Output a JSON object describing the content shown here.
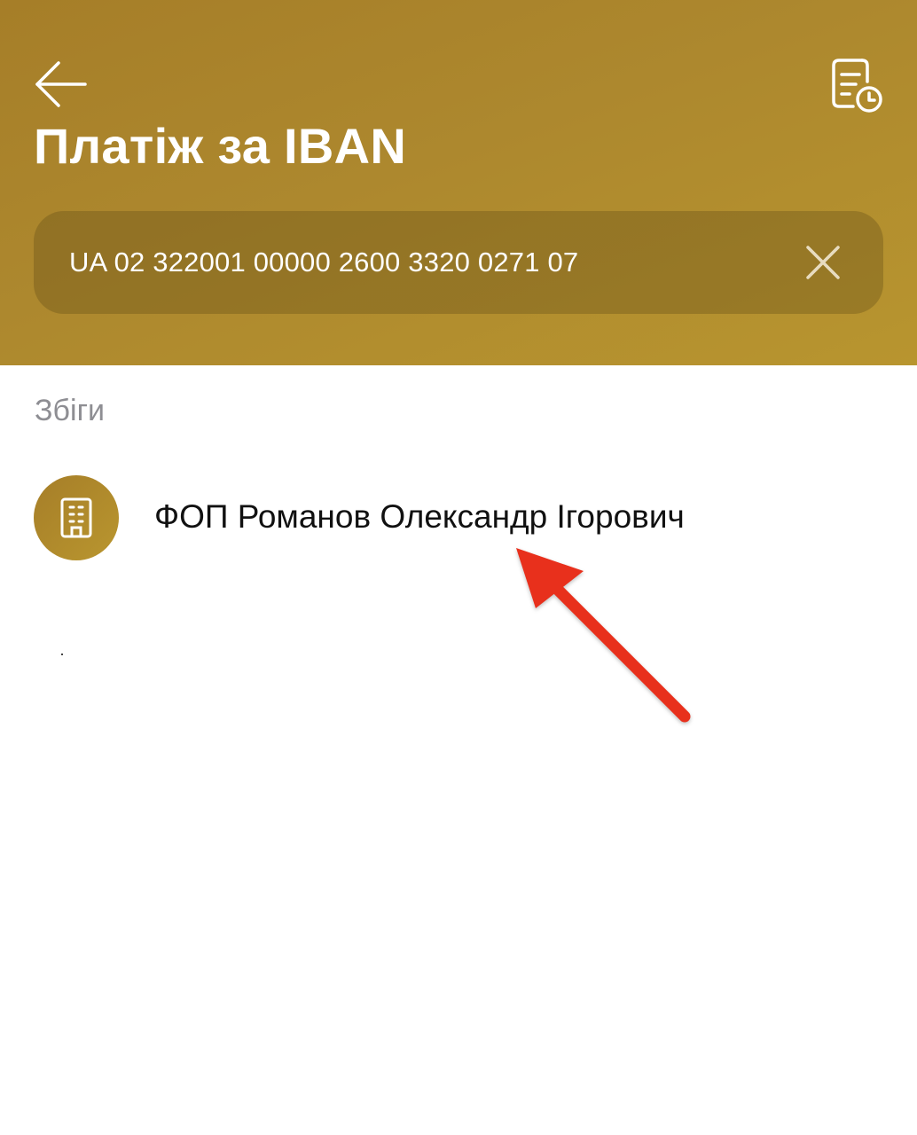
{
  "header": {
    "title": "Платіж за IBAN",
    "back_icon": "arrow-left-icon",
    "history_icon": "document-clock-icon"
  },
  "iban_field": {
    "value": "UA 02 322001 00000 2600 3320 0271 07",
    "clear_icon": "close-icon"
  },
  "matches": {
    "label": "Збіги",
    "items": [
      {
        "name": "ФОП Романов Олександр Ігорович",
        "icon": "building-icon"
      }
    ]
  },
  "colors": {
    "header_gold": "#ad882e",
    "annotation_arrow": "#e8301c",
    "text_dark": "#111111",
    "text_muted": "#8e8e93"
  }
}
